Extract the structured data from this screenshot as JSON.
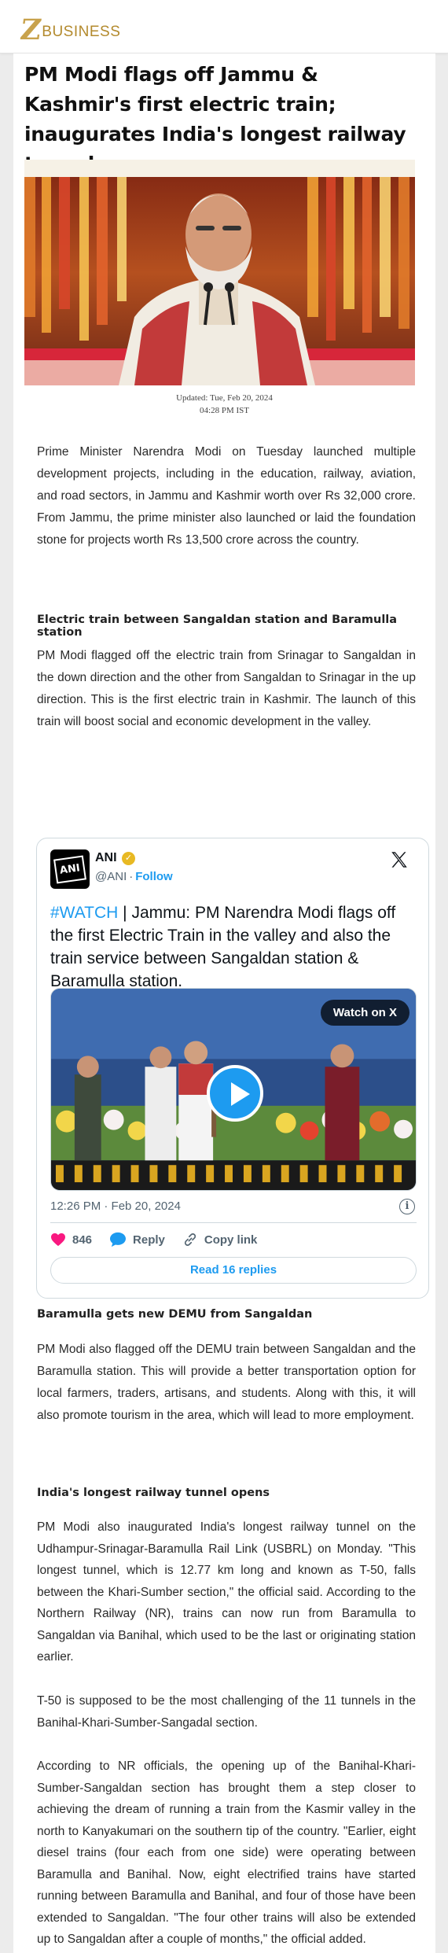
{
  "brand": {
    "logo_mark": "Z",
    "logo_word": "BUSINESS",
    "color": "#c8a24c"
  },
  "article": {
    "headline": "PM Modi flags off Jammu & Kashmir's first electric train; inaugurates India's longest railway tunnel",
    "updated": "Updated: Tue, Feb 20, 2024",
    "updated_time": "04:28 PM IST",
    "para_1": "Prime Minister Narendra Modi on Tuesday launched multiple development projects, including in the education, railway, aviation, and road sectors, in Jammu and Kashmir worth over Rs 32,000 crore. From Jammu, the prime minister also launched or laid the foundation stone for projects worth Rs 13,500 crore across the country.",
    "sub_1": "Electric train between Sangaldan station and Baramulla station",
    "para_2": "PM Modi flagged off the electric train from Srinagar to Sangaldan in the down direction and the other from Sangaldan to Srinagar in the up direction. This is the first electric train in Kashmir. The launch of this train will boost social and economic development in the valley.",
    "sub_2": "Baramulla gets new DEMU from Sangaldan",
    "para_3": "PM Modi also flagged off the DEMU train between Sangaldan and the Baramulla station. This will provide a better transportation option for local farmers, traders, artisans, and students. Along with this, it will also promote tourism in the area, which will lead to more employment.",
    "sub_3": "India's longest railway tunnel opens",
    "para_4": "PM Modi also inaugurated India's longest railway tunnel on the Udhampur-Srinagar-Baramulla Rail Link (USBRL) on Monday. \"This longest tunnel, which is 12.77 km long and known as T-50, falls between the Khari-Sumber section,\" the official said. According to the Northern Railway (NR), trains can now run from Baramulla to Sangaldan via Banihal, which used to be the last or originating station earlier.",
    "para_5": "T-50 is supposed to be the most challenging of the 11 tunnels in the Banihal-Khari-Sumber-Sangadal section.",
    "para_6": "According to NR officials, the opening up of the Banihal-Khari-Sumber-Sangaldan section has brought them a step closer to achieving the dream of running a train from the Kasmir valley in the north to Kanyakumari on the southern tip of the country. \"Earlier, eight diesel trains (four each from one side) were operating between Baramulla and Banihal. Now, eight electrified trains have started running between Baramulla and Banihal, and four of those have been extended to Sangaldan. \"The four other trains will also be extended up to Sangaldan after a couple of months,\" the official added."
  },
  "tweet": {
    "avatar_text": "ANI",
    "name": "ANI",
    "handle": "@ANI",
    "separator": "·",
    "follow": "Follow",
    "hashtag": "#WATCH",
    "text": " | Jammu: PM Narendra Modi flags off the first Electric Train in the valley and also the train service between Sangaldan station & Baramulla station.",
    "watch_label": "Watch on X",
    "timestamp": "12:26 PM · Feb 20, 2024",
    "info_glyph": "i",
    "likes": "846",
    "reply_label": "Reply",
    "copy_label": "Copy link",
    "replies_button": "Read 16 replies",
    "like_color": "#f91880",
    "link_color": "#1d9bf0"
  }
}
